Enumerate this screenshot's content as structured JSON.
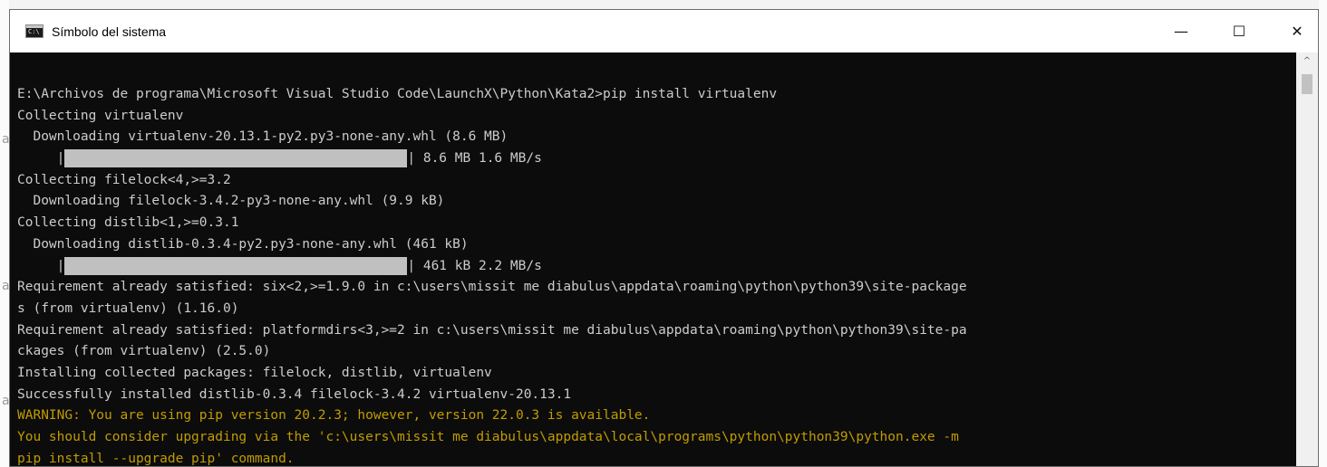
{
  "window": {
    "title": "Símbolo del sistema",
    "controls": {
      "minimize": "—",
      "maximize": "☐",
      "close": "✕"
    }
  },
  "scrollbar": {
    "up_arrow": "^"
  },
  "background": {
    "left_glyphs": [
      "a",
      "a",
      "a"
    ]
  },
  "terminal": {
    "lines": [
      {
        "text": "E:\\Archivos de programa\\Microsoft Visual Studio Code\\LaunchX\\Python\\Kata2>pip install virtualenv"
      },
      {
        "text": "Collecting virtualenv"
      },
      {
        "text": "  Downloading virtualenv-20.13.1-py2.py3-none-any.whl (8.6 MB)"
      },
      {
        "prefix": "     |",
        "suffix": "| 8.6 MB 1.6 MB/s",
        "progress": 1.0
      },
      {
        "text": "Collecting filelock<4,>=3.2"
      },
      {
        "text": "  Downloading filelock-3.4.2-py3-none-any.whl (9.9 kB)"
      },
      {
        "text": "Collecting distlib<1,>=0.3.1"
      },
      {
        "text": "  Downloading distlib-0.3.4-py2.py3-none-any.whl (461 kB)"
      },
      {
        "prefix": "     |",
        "suffix": "| 461 kB 2.2 MB/s",
        "progress": 1.0
      },
      {
        "text": "Requirement already satisfied: six<2,>=1.9.0 in c:\\users\\missit me diabulus\\appdata\\roaming\\python\\python39\\site-package"
      },
      {
        "text": "s (from virtualenv) (1.16.0)"
      },
      {
        "text": "Requirement already satisfied: platformdirs<3,>=2 in c:\\users\\missit me diabulus\\appdata\\roaming\\python\\python39\\site-pa"
      },
      {
        "text": "ckages (from virtualenv) (2.5.0)"
      },
      {
        "text": "Installing collected packages: filelock, distlib, virtualenv"
      },
      {
        "text": "Successfully installed distlib-0.3.4 filelock-3.4.2 virtualenv-20.13.1"
      },
      {
        "text": "WARNING: You are using pip version 20.2.3; however, version 22.0.3 is available.",
        "warn": true
      },
      {
        "text": "You should consider upgrading via the 'c:\\users\\missit me diabulus\\appdata\\local\\programs\\python\\python39\\python.exe -m",
        "warn": true
      },
      {
        "text": "pip install --upgrade pip' command.",
        "warn": true
      }
    ]
  },
  "colors": {
    "terminal_bg": "#0c0c0c",
    "terminal_fg": "#cccccc",
    "warning_fg": "#c19c00",
    "progress_fill": "#c0c0c0"
  }
}
